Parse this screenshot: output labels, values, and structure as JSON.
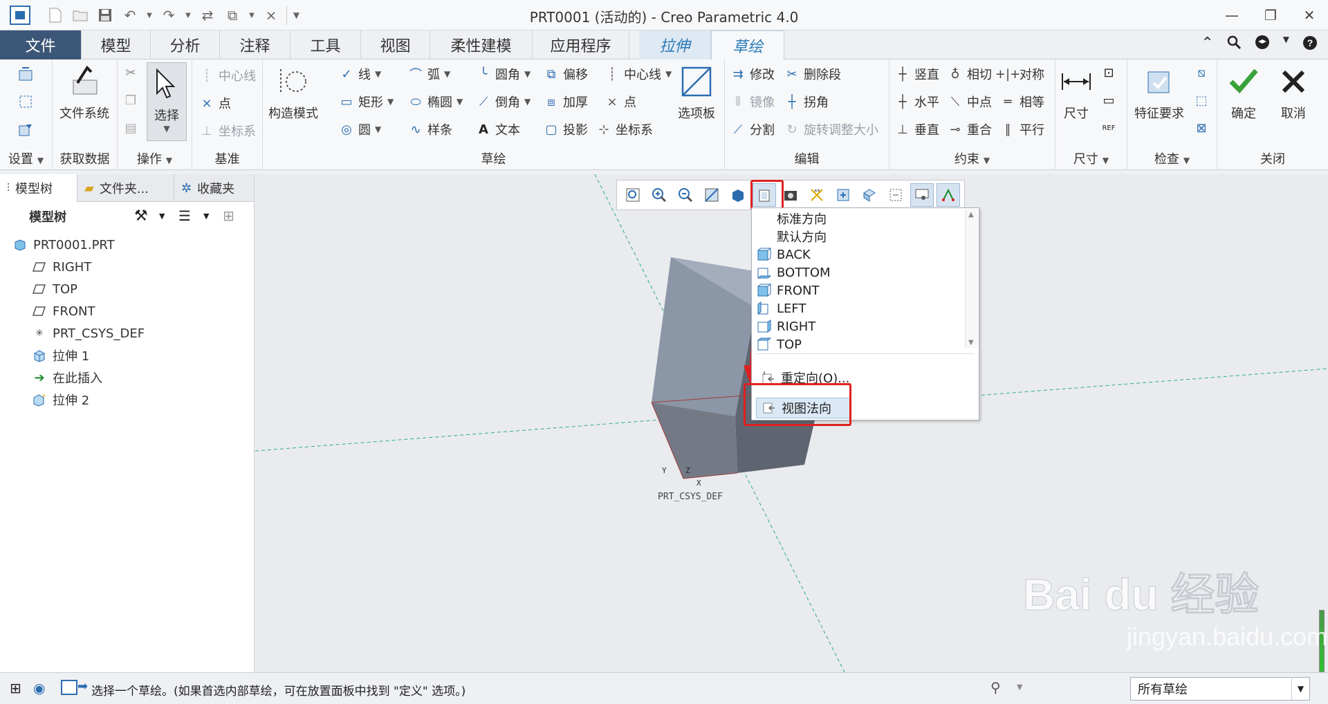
{
  "window": {
    "title": "PRT0001 (活动的) - Creo Parametric 4.0"
  },
  "tabs": [
    {
      "label": "文件"
    },
    {
      "label": "模型"
    },
    {
      "label": "分析"
    },
    {
      "label": "注释"
    },
    {
      "label": "工具"
    },
    {
      "label": "视图"
    },
    {
      "label": "柔性建模"
    },
    {
      "label": "应用程序"
    },
    {
      "label": "拉伸"
    },
    {
      "label": "草绘"
    }
  ],
  "ribbon": {
    "groups": {
      "settings": "设置",
      "get_data": "获取数据",
      "operations": "操作",
      "datum": "基准",
      "sketch": "草绘",
      "edit": "编辑",
      "constrain": "约束",
      "dimension": "尺寸",
      "inspect": "检查",
      "close": "关闭"
    },
    "file_system": "文件系统",
    "select": "选择",
    "datum_centerline": "中心线",
    "datum_point": "点",
    "datum_csys": "坐标系",
    "construction_mode": "构造模式",
    "sketch_line": "线",
    "sketch_arc": "弧",
    "sketch_fillet": "圆角",
    "sketch_offset": "偏移",
    "sketch_centerline": "中心线",
    "sketch_rect": "矩形",
    "sketch_ellipse": "椭圆",
    "sketch_chamfer": "倒角",
    "sketch_thicken": "加厚",
    "sketch_point": "点",
    "sketch_circle": "圆",
    "sketch_spline": "样条",
    "sketch_text": "文本",
    "sketch_project": "投影",
    "sketch_csys": "坐标系",
    "palette": "选项板",
    "edit_modify": "修改",
    "edit_delete_segment": "删除段",
    "edit_mirror": "镜像",
    "edit_corner": "拐角",
    "edit_divide": "分割",
    "edit_rotate_resize": "旋转调整大小",
    "con_vertical": "竖直",
    "con_tangent": "相切",
    "con_symmetric": "对称",
    "con_horizontal": "水平",
    "con_midpoint": "中点",
    "con_equal": "相等",
    "con_perpendicular": "垂直",
    "con_coincident": "重合",
    "con_parallel": "平行",
    "dim_label": "尺寸",
    "feature_requirements": "特征要求",
    "ok": "确定",
    "cancel": "取消"
  },
  "panel_tabs": [
    {
      "label": "模型树"
    },
    {
      "label": "文件夹..."
    },
    {
      "label": "收藏夹"
    }
  ],
  "model_tree": {
    "header": "模型树",
    "nodes": [
      {
        "label": "PRT0001.PRT",
        "icon": "part-icon"
      },
      {
        "label": "RIGHT",
        "icon": "datum-plane-icon"
      },
      {
        "label": "TOP",
        "icon": "datum-plane-icon"
      },
      {
        "label": "FRONT",
        "icon": "datum-plane-icon"
      },
      {
        "label": "PRT_CSYS_DEF",
        "icon": "csys-icon"
      },
      {
        "label": "拉伸 1",
        "icon": "extrude-icon"
      },
      {
        "label": "在此插入",
        "icon": "insert-arrow-icon"
      },
      {
        "label": "拉伸 2",
        "icon": "extrude-new-icon"
      }
    ]
  },
  "view_menu": {
    "items": [
      {
        "label": "标准方向"
      },
      {
        "label": "默认方向"
      },
      {
        "label": "BACK"
      },
      {
        "label": "BOTTOM"
      },
      {
        "label": "FRONT"
      },
      {
        "label": "LEFT"
      },
      {
        "label": "RIGHT"
      },
      {
        "label": "TOP"
      }
    ],
    "reorient": "重定向(O)...",
    "sketch_view": "视图法向"
  },
  "graphics": {
    "csys_label": "PRT_CSYS_DEF",
    "axis_x": "X",
    "axis_y": "Y",
    "axis_z": "Z"
  },
  "watermark": {
    "brand": "Bai du 经验",
    "url": "jingyan.baidu.com"
  },
  "status": {
    "message": "选择一个草绘。(如果首选内部草绘，可在放置面板中找到 \"定义\" 选项。)",
    "filter": "所有草绘"
  },
  "colors": {
    "file_tab": "#3c5677",
    "context_tab_text": "#2a7ab8",
    "highlight": "#e02020",
    "accent": "#2b6cb0"
  }
}
